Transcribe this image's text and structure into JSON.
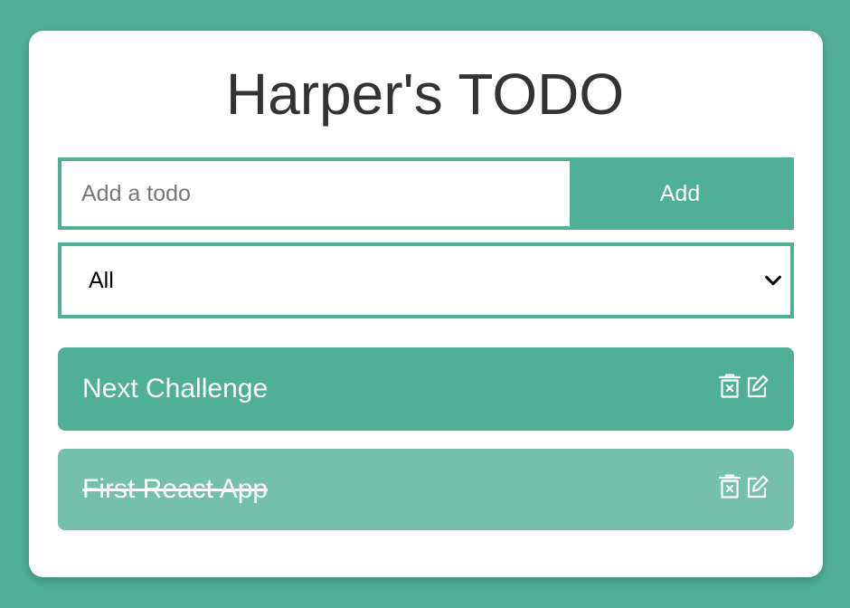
{
  "app": {
    "title": "Harper's TODO"
  },
  "add_form": {
    "placeholder": "Add a todo",
    "button_label": "Add"
  },
  "filter": {
    "selected": "All"
  },
  "colors": {
    "background": "#50b096",
    "card": "#ffffff",
    "todo_active": "#50b096",
    "todo_completed": "#74c0ab",
    "title_text": "#333333"
  },
  "todos": [
    {
      "text": "Next Challenge",
      "completed": false,
      "icons": [
        "trash-icon",
        "edit-icon"
      ]
    },
    {
      "text": "First React App",
      "completed": true,
      "icons": [
        "trash-icon",
        "edit-icon"
      ]
    }
  ]
}
